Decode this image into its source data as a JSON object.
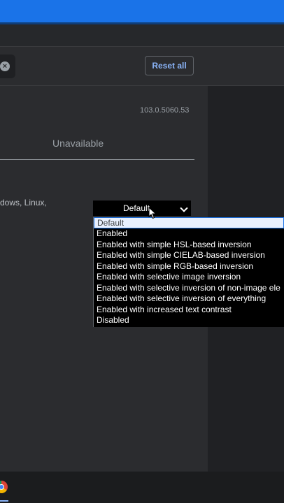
{
  "header": {
    "reset_label": "Reset all"
  },
  "flag": {
    "version": "103.0.5060.53",
    "unavailable_label": "Unavailable",
    "description_fragment": "dows, Linux,",
    "selected_value": "Default",
    "options": [
      "Default",
      "Enabled",
      "Enabled with simple HSL-based inversion",
      "Enabled with simple CIELAB-based inversion",
      "Enabled with simple RGB-based inversion",
      "Enabled with selective image inversion",
      "Enabled with selective inversion of non-image ele",
      "Enabled with selective inversion of everything",
      "Enabled with increased text contrast",
      "Disabled"
    ]
  },
  "icons": {
    "clear": "clear-icon",
    "chevron": "chevron-down-icon",
    "cursor": "cursor-icon",
    "taskbar": "chrome-icon"
  },
  "colors": {
    "accent": "#1a73e8",
    "link": "#8ab4f8",
    "surface": "#2b2c2f",
    "background": "#202124"
  }
}
